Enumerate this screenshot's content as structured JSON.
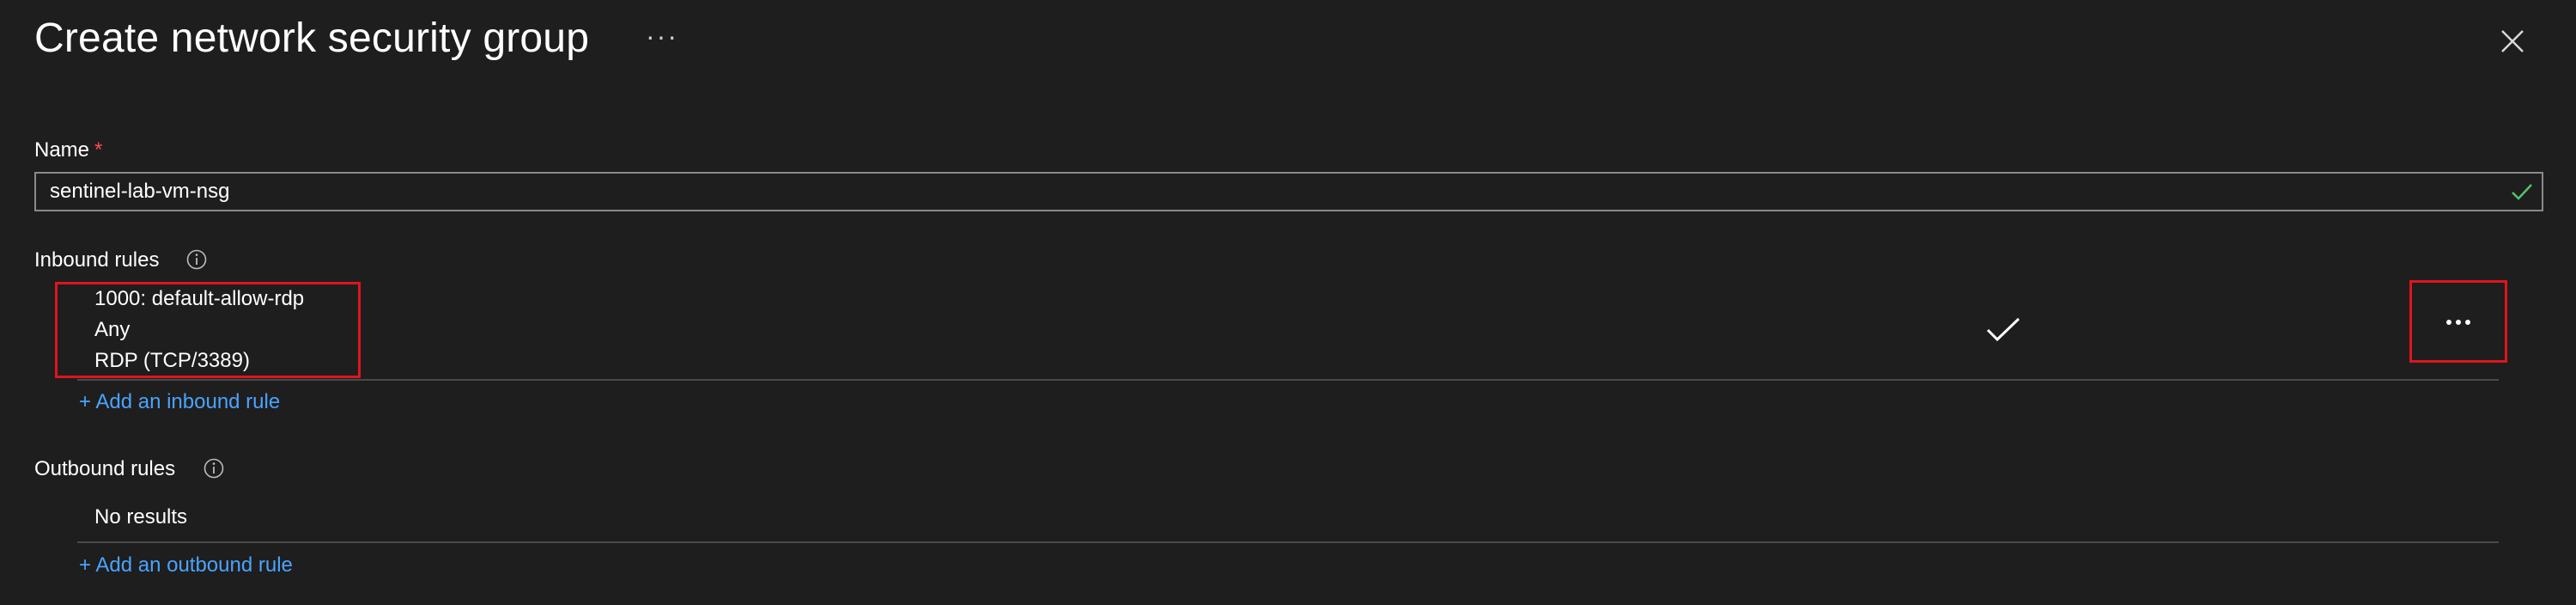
{
  "header": {
    "title": "Create network security group",
    "more_label": "···"
  },
  "form": {
    "name_label": "Name",
    "required_marker": "*",
    "name_value": "sentinel-lab-vm-nsg"
  },
  "inbound": {
    "label": "Inbound rules",
    "rules": [
      {
        "priority_name": "1000: default-allow-rdp",
        "source": "Any",
        "service": "RDP (TCP/3389)",
        "action": "allow"
      }
    ],
    "add_label": "+ Add an inbound rule"
  },
  "outbound": {
    "label": "Outbound rules",
    "empty_text": "No results",
    "add_label": "+ Add an outbound rule"
  },
  "colors": {
    "background": "#1e1e1e",
    "link": "#4aa3ff",
    "highlight": "#e0141e",
    "required": "#ff4b4b",
    "valid": "#57c26a"
  },
  "icons": {
    "close": "close-icon",
    "valid": "checkmark-icon",
    "info": "info-icon",
    "allow": "checkmark-icon",
    "more": "ellipsis-icon"
  }
}
